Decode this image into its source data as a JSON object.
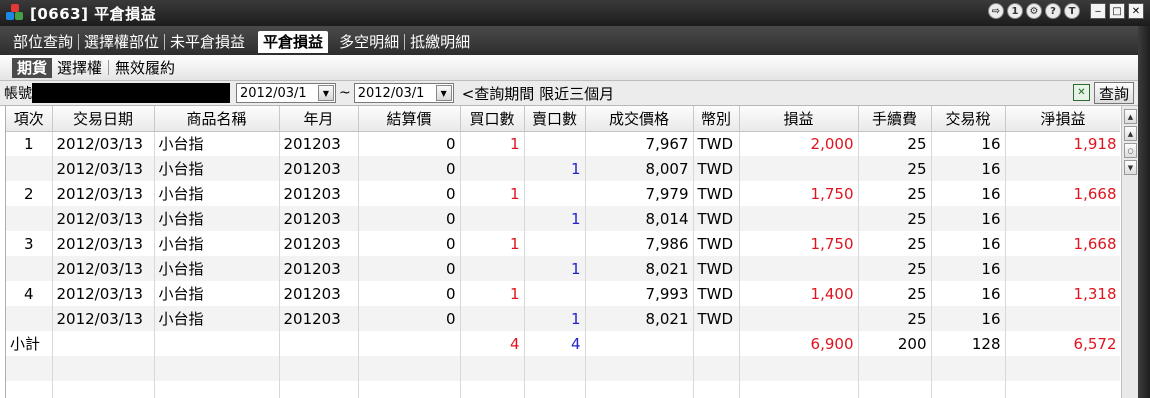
{
  "window": {
    "title": "[0663] 平倉損益"
  },
  "title_tools": [
    "⇨",
    "1",
    "⚙",
    "?",
    "T"
  ],
  "window_buttons": [
    "‒",
    "□",
    "✕"
  ],
  "tabs_main": [
    {
      "label": "部位查詢"
    },
    {
      "label": "選擇權部位"
    },
    {
      "label": "未平倉損益"
    },
    {
      "label": "平倉損益",
      "active": true
    },
    {
      "label": "多空明細"
    },
    {
      "label": "抵繳明細"
    }
  ],
  "tabs_sub": [
    {
      "label": "期貨",
      "active": true
    },
    {
      "label": "選擇權"
    },
    {
      "label": "無效履約"
    }
  ],
  "query": {
    "account_label": "帳號",
    "date_from": "2012/03/1",
    "separator": "~",
    "date_to": "2012/03/1",
    "note": "<查詢期間 限近三個月",
    "query_button": "查詢"
  },
  "table": {
    "columns": [
      "項次",
      "交易日期",
      "商品名稱",
      "年月",
      "結算價",
      "買口數",
      "賣口數",
      "成交價格",
      "幣別",
      "損益",
      "手續費",
      "交易稅",
      "淨損益"
    ],
    "rows": [
      [
        "1",
        "2012/03/13",
        "小台指",
        "201203",
        "0",
        "1",
        "",
        "7,967",
        "TWD",
        "2,000",
        "25",
        "16",
        "1,918"
      ],
      [
        "",
        "2012/03/13",
        "小台指",
        "201203",
        "0",
        "",
        "1",
        "8,007",
        "TWD",
        "",
        "25",
        "16",
        ""
      ],
      [
        "2",
        "2012/03/13",
        "小台指",
        "201203",
        "0",
        "1",
        "",
        "7,979",
        "TWD",
        "1,750",
        "25",
        "16",
        "1,668"
      ],
      [
        "",
        "2012/03/13",
        "小台指",
        "201203",
        "0",
        "",
        "1",
        "8,014",
        "TWD",
        "",
        "25",
        "16",
        ""
      ],
      [
        "3",
        "2012/03/13",
        "小台指",
        "201203",
        "0",
        "1",
        "",
        "7,986",
        "TWD",
        "1,750",
        "25",
        "16",
        "1,668"
      ],
      [
        "",
        "2012/03/13",
        "小台指",
        "201203",
        "0",
        "",
        "1",
        "8,021",
        "TWD",
        "",
        "25",
        "16",
        ""
      ],
      [
        "4",
        "2012/03/13",
        "小台指",
        "201203",
        "0",
        "1",
        "",
        "7,993",
        "TWD",
        "1,400",
        "25",
        "16",
        "1,318"
      ],
      [
        "",
        "2012/03/13",
        "小台指",
        "201203",
        "0",
        "",
        "1",
        "8,021",
        "TWD",
        "",
        "25",
        "16",
        ""
      ],
      [
        "小計",
        "",
        "",
        "",
        "",
        "4",
        "4",
        "",
        "",
        "6,900",
        "200",
        "128",
        "6,572"
      ],
      [
        "",
        "",
        "",
        "",
        "",
        "",
        "",
        "",
        "",
        "",
        "",
        "",
        ""
      ],
      [
        "",
        "",
        "",
        "",
        "",
        "",
        "",
        "",
        "",
        "",
        "",
        "",
        ""
      ]
    ]
  },
  "colors": {
    "buy": "#e0141e",
    "sell": "#2323c8",
    "profit": "#e0141e"
  }
}
